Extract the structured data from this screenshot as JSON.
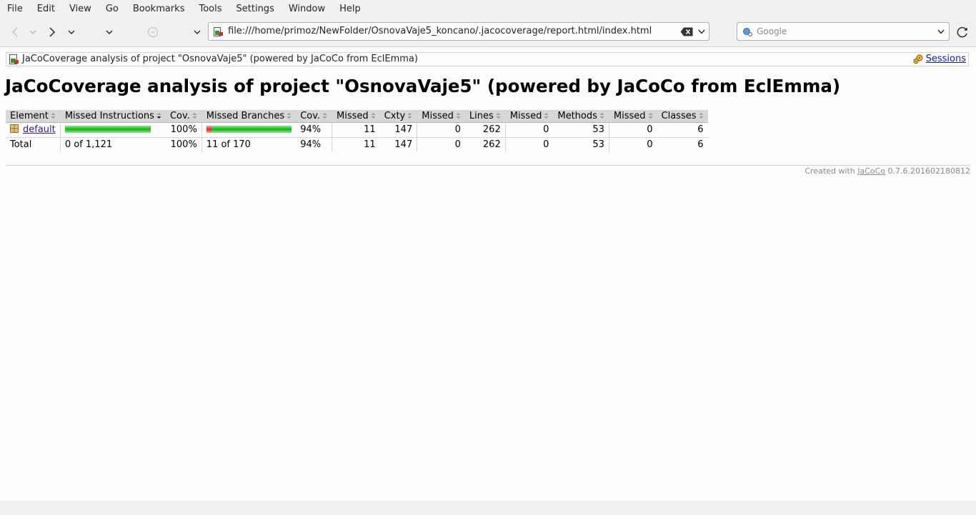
{
  "menu": [
    "File",
    "Edit",
    "View",
    "Go",
    "Bookmarks",
    "Tools",
    "Settings",
    "Window",
    "Help"
  ],
  "url_bar": {
    "value": "file:///home/primoz/NewFolder/OsnovaVaje5_koncano/.jacocoverage/report.html/index.html"
  },
  "search_bar": {
    "placeholder": "Google"
  },
  "breadcrumb": {
    "text": "JaCoCoverage analysis of project \"OsnovaVaje5\" (powered by JaCoCo from EclEmma)",
    "sessions": "Sessions"
  },
  "page_title": "JaCoCoverage analysis of project \"OsnovaVaje5\" (powered by JaCoCo from EclEmma)",
  "table": {
    "headers": [
      "Element",
      "Missed Instructions",
      "Cov.",
      "Missed Branches",
      "Cov.",
      "Missed",
      "Cxty",
      "Missed",
      "Lines",
      "Missed",
      "Methods",
      "Missed",
      "Classes"
    ],
    "rows": [
      {
        "element": "default",
        "instructions_missed_fraction": 0,
        "instructions_cov": "100%",
        "branches_missed_fraction": 0.065,
        "branches_cov": "94%",
        "missed_cxty": "11",
        "cxty": "147",
        "missed_lines": "0",
        "lines": "262",
        "missed_methods": "0",
        "methods": "53",
        "missed_classes": "0",
        "classes": "6"
      }
    ],
    "total": {
      "label": "Total",
      "instructions": "0 of 1,121",
      "instructions_cov": "100%",
      "branches": "11 of 170",
      "branches_cov": "94%",
      "missed_cxty": "11",
      "cxty": "147",
      "missed_lines": "0",
      "lines": "262",
      "missed_methods": "0",
      "methods": "53",
      "missed_classes": "0",
      "classes": "6"
    }
  },
  "footer": {
    "prefix": "Created with",
    "link": "JaCoCo",
    "version": "0.7.6.201602180812"
  }
}
